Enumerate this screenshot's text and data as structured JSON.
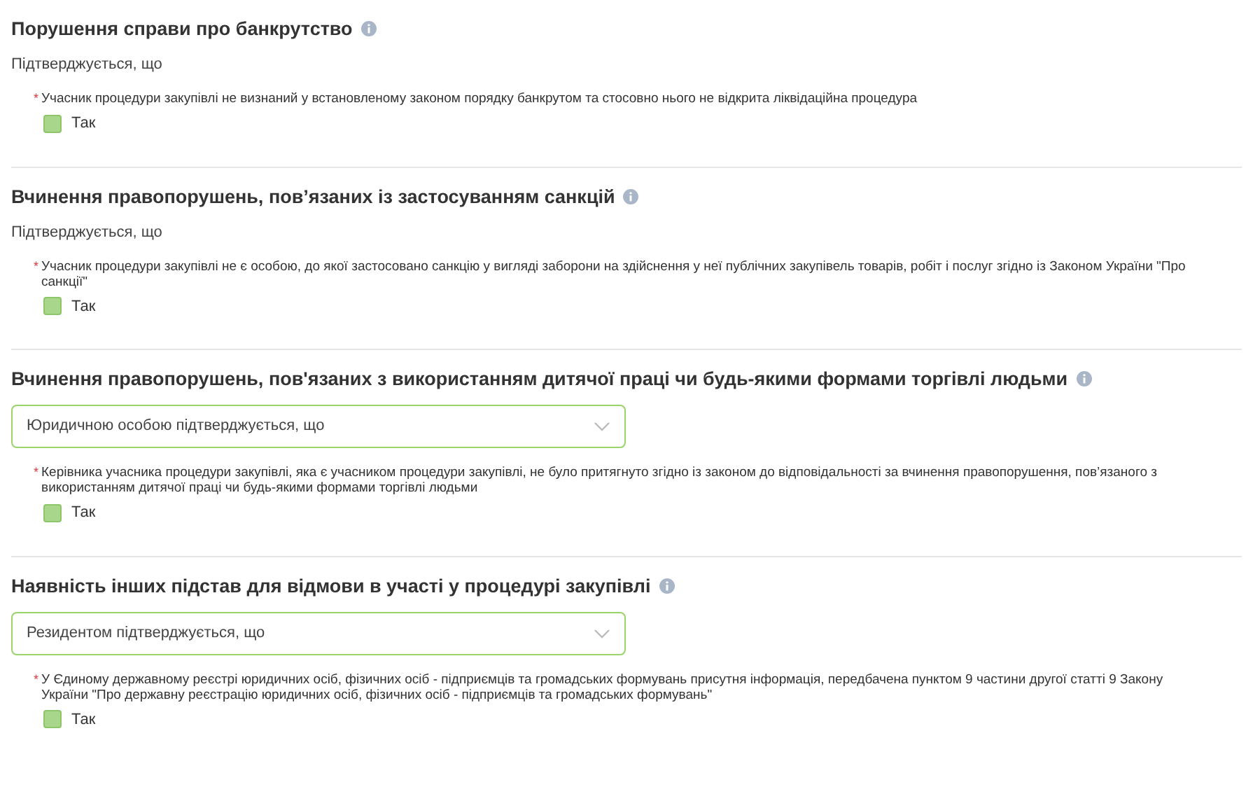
{
  "sections": [
    {
      "title": "Порушення справи про банкрутство",
      "kind": "text",
      "subtitle": "Підтверджується, що",
      "requirement": "Учасник процедури закупівлі не визнаний у встановленому законом порядку банкрутом та стосовно нього не відкрита ліквідаційна процедура",
      "required_mark": "*",
      "option": {
        "label": "Так",
        "checked": true
      }
    },
    {
      "title": "Вчинення правопорушень, пов’язаних із застосуванням санкцій",
      "kind": "text",
      "subtitle": "Підтверджується, що",
      "requirement": "Учасник процедури закупівлі не є особою, до якої застосовано санкцію у вигляді заборони на здійснення у неї публічних закупівель товарів, робіт і послуг згідно із Законом України \"Про санкції\"",
      "required_mark": "*",
      "option": {
        "label": "Так",
        "checked": true
      }
    },
    {
      "title": "Вчинення правопорушень, пов'язаних з використанням дитячої праці чи будь-якими формами торгівлі людьми",
      "kind": "dropdown",
      "value": "Юридичною особою підтверджується, що",
      "requirement": "Керівника учасника процедури закупівлі, яка є учасником процедури закупівлі, не було притягнуто згідно із законом до відповідальності за вчинення правопорушення, пов’язаного з використанням дитячої праці чи будь-якими формами торгівлі людьми",
      "required_mark": "*",
      "option": {
        "label": "Так",
        "checked": true
      }
    },
    {
      "title": "Наявність інших підстав для відмови в участі у процедурі закупівлі",
      "kind": "dropdown",
      "value": "Резидентом підтверджується, що",
      "requirement": "У Єдиному державному реєстрі юридичних осіб, фізичних осіб - підприємців та громадських формувань присутня інформація, передбачена пунктом 9 частини другої статті 9 Закону України \"Про державну реєстрацію юридичних осіб, фізичних осіб - підприємців та громадських формувань\"",
      "required_mark": "*",
      "option": {
        "label": "Так",
        "checked": true
      }
    }
  ]
}
